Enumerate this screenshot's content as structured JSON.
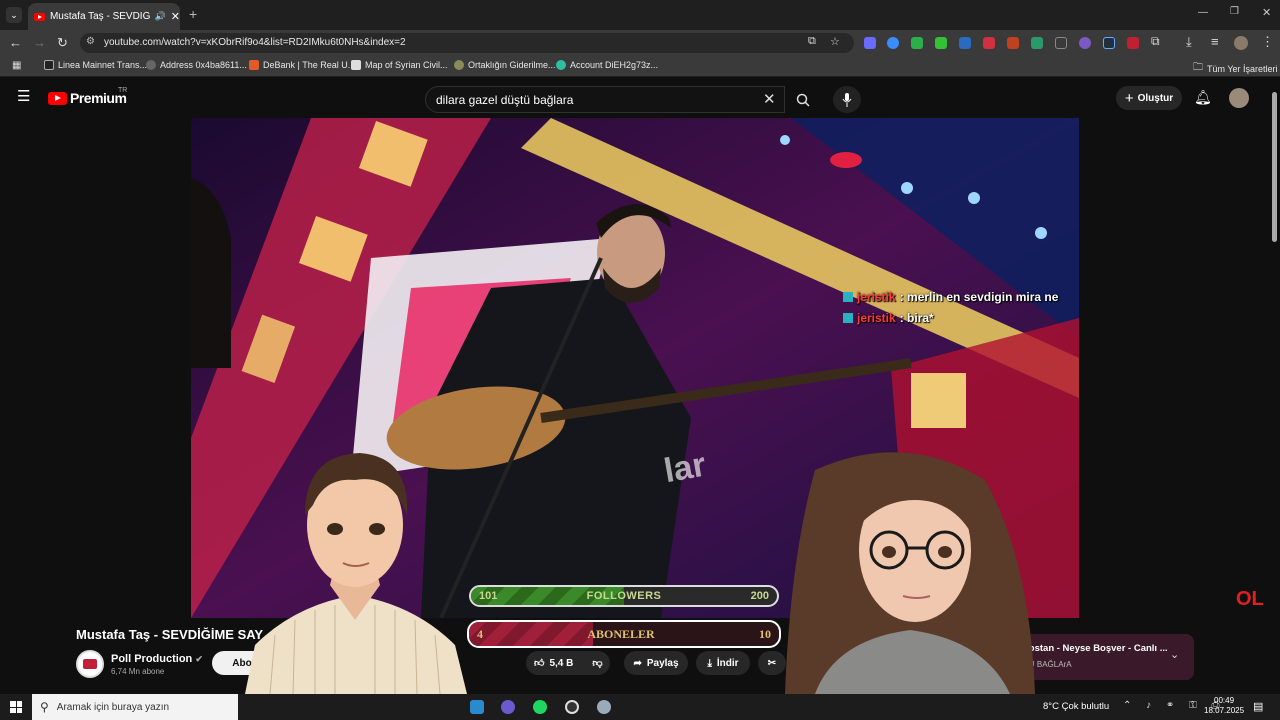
{
  "browser": {
    "tab_title": "Mustafa Taş - SEVDİĞİME S",
    "new_tab": "+",
    "url": "youtube.com/watch?v=xKObrRif9o4&list=RD2IMku6t0NHs&index=2",
    "bookmarks": [
      "Linea Mainnet Trans...",
      "Address 0x4ba8611...",
      "DeBank | The Real U...",
      "Map of Syrian Civil...",
      "Ortaklığın Giderilme...",
      "Account DiEH2g73z..."
    ],
    "all_bookmarks": "Tüm Yer İşaretleri"
  },
  "youtube": {
    "logo": "Premium",
    "region": "TR",
    "search_value": "dilara gazel düştü bağlara",
    "create_label": "Oluştur",
    "video_title": "Mustafa Taş - SEVDİĞİME SAY",
    "channel_name": "Poll Production",
    "subscribers": "6,74 Mn abone",
    "subscribe_label": "Abo",
    "like_count": "5,4 B",
    "share_label": "Paylaş",
    "download_label": "İndir",
    "next_video_title": "k Bostan - Neyse Boşver - Canlı ...",
    "next_video_sub": "TU BAĞLArA"
  },
  "overlay": {
    "chat": [
      {
        "user": "jeristik",
        "text": ": merlin en sevdigin mira ne"
      },
      {
        "user": "jeristik",
        "text": ": bira*"
      }
    ],
    "followers": {
      "label": "FOLLOWERS",
      "current": "101",
      "goal": "200",
      "progress": 0.5
    },
    "aboneler": {
      "label": "ABONELER",
      "current": "4",
      "goal": "10",
      "progress": 0.4
    },
    "watermark": "OL"
  },
  "taskbar": {
    "search_placeholder": "Aramak için buraya yazın",
    "weather": "8°C  Çok bulutlu",
    "time": "00:49",
    "date": "18.07.2025"
  },
  "colors": {
    "youtube_red": "#ff0000",
    "followers_green": "#3a8a2a",
    "aboneler_red": "#a0203a"
  }
}
